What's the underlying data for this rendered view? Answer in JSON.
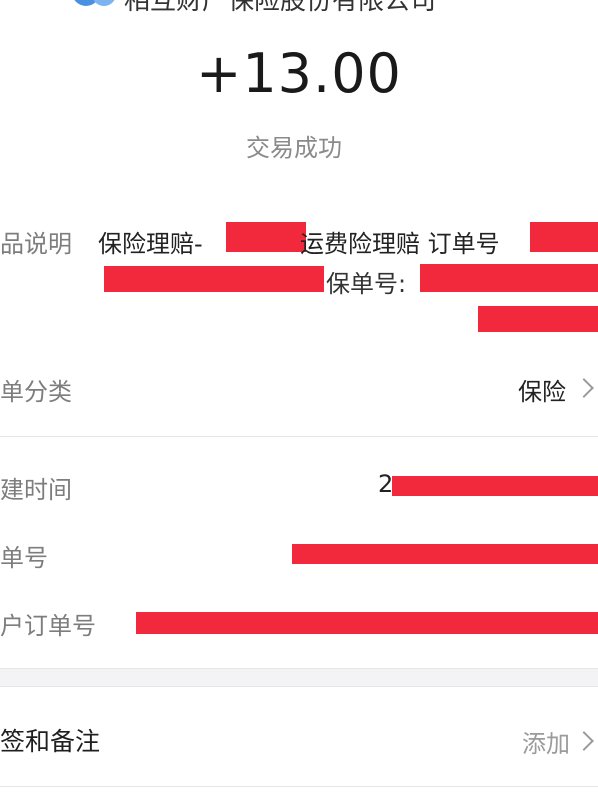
{
  "header": {
    "merchant_name": "相互财产保险股份有限公司",
    "logo_icon": "insurance-logo-icon"
  },
  "amount": "+13.00",
  "status": "交易成功",
  "description": {
    "label": "品说明",
    "line1": "保险理赔-",
    "line1_mid": "运费险理赔 订单号",
    "line2_mid": "保单号:"
  },
  "category": {
    "label": "单分类",
    "value": "保险"
  },
  "details": {
    "create_time_label": "建时间",
    "create_time_value_start": "2",
    "order_no_label": "单号",
    "merchant_order_label": "户订单号"
  },
  "tags": {
    "label": "签和备注",
    "action": "添加"
  },
  "colors": {
    "redaction": "#f2283c",
    "section_gap": "#f3f3f5"
  }
}
